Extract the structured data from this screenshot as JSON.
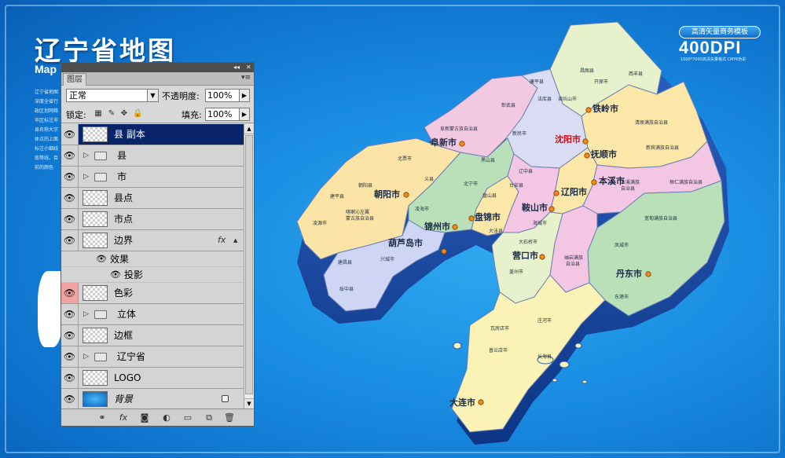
{
  "poster": {
    "title": "辽宁省地图",
    "subtitle": "Map",
    "description": "辽宁省地图深度全省行政区划网络市区标注市县名称大字体点的上面标注小细线底等线，目前的颜色",
    "brand_badge": "高清矢量商务模板",
    "brand_main": "400DPI",
    "brand_small": "1000*7000高清矢量格式 CMYK色彩"
  },
  "map": {
    "cities": [
      {
        "name": "铁岭市"
      },
      {
        "name": "阜新市"
      },
      {
        "name": "沈阳市"
      },
      {
        "name": "抚顺市"
      },
      {
        "name": "朝阳市"
      },
      {
        "name": "本溪市"
      },
      {
        "name": "辽阳市"
      },
      {
        "name": "锦州市"
      },
      {
        "name": "鞍山市"
      },
      {
        "name": "葫芦岛市"
      },
      {
        "name": "营口市"
      },
      {
        "name": "丹东市"
      },
      {
        "name": "大连市"
      }
    ],
    "counties": [
      "昌图县",
      "开原市",
      "西丰县",
      "康平县",
      "法库县",
      "调兵山市",
      "彰武县",
      "新民市",
      "辽中县",
      "清原满族自治县",
      "新宾满族自治县",
      "阜新蒙古族自治县",
      "北票市",
      "黑山县",
      "台安县",
      "义县",
      "北宁市",
      "凌海市",
      "朝阳县",
      "建平县",
      "喀喇沁左翼蒙古族自治县",
      "凌源市",
      "建昌县",
      "兴城市",
      "绥中县",
      "盘山县",
      "大洼县",
      "海城市",
      "岫岩满族自治县",
      "桓仁满族自治县",
      "宽甸满族自治县",
      "凤城市",
      "东港市",
      "大石桥市",
      "盖州市",
      "瓦房店市",
      "普兰店市",
      "庄河市",
      "长海县",
      "灯塔市",
      "辽阳县",
      "本溪满族自治县",
      "抚顺县",
      "铁岭县"
    ]
  },
  "layers_panel": {
    "tab": "图层",
    "blend_mode": "正常",
    "opacity_label": "不透明度:",
    "opacity_value": "100%",
    "lock_label": "锁定:",
    "fill_label": "填充:",
    "fill_value": "100%",
    "layers": [
      {
        "name": "县 副本",
        "type": "layer",
        "selected": true
      },
      {
        "name": "县",
        "type": "group"
      },
      {
        "name": "市",
        "type": "group"
      },
      {
        "name": "县点",
        "type": "layer"
      },
      {
        "name": "市点",
        "type": "layer"
      },
      {
        "name": "边界",
        "type": "layer",
        "fx": "fx"
      },
      {
        "name": "效果",
        "type": "effect-group"
      },
      {
        "name": "投影",
        "type": "effect"
      },
      {
        "name": "色彩",
        "type": "layer",
        "eye_highlight": true
      },
      {
        "name": "立体",
        "type": "group"
      },
      {
        "name": "边框",
        "type": "layer"
      },
      {
        "name": "辽宁省",
        "type": "group"
      },
      {
        "name": "LOGO",
        "type": "layer"
      },
      {
        "name": "背景",
        "type": "layer",
        "locked": true
      }
    ]
  },
  "colors": {
    "background": "#1a8ee3",
    "selected_layer": "#0a246a",
    "capital_label": "#c0141c"
  }
}
